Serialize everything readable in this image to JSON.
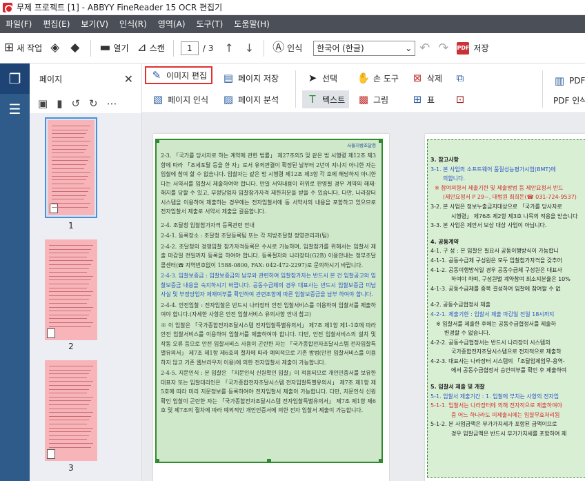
{
  "window": {
    "title": "무제 프로젝트 [1] - ABBYY FineReader 15 OCR 편집기"
  },
  "menu": [
    "파일(F)",
    "편집(E)",
    "보기(V)",
    "인식(R)",
    "영역(A)",
    "도구(T)",
    "도움말(H)"
  ],
  "toolbar": {
    "new_task": "새 작업",
    "open": "열기",
    "scan": "스캔",
    "page_current": "1",
    "page_total": "/ 3",
    "recognize": "인식",
    "language": "한국어 (한글)",
    "save": "저장"
  },
  "pages_panel": {
    "title": "페이지",
    "thumbnails": [
      {
        "number": "1"
      },
      {
        "number": "2"
      },
      {
        "number": "3"
      }
    ]
  },
  "edit_toolbar": {
    "image_edit": "이미지 편집",
    "save_page": "페이지 저장",
    "recognize_page": "페이지 인식",
    "analyze_page": "페이지 분석",
    "select": "선택",
    "hand_tool": "손 도구",
    "delete": "삭제",
    "text": "텍스트",
    "picture": "그림",
    "table": "표",
    "pdf": "PDF",
    "pdf_recognize": "PDF 인식"
  },
  "document": {
    "page1_logo": "서울지방조달청",
    "page1_paragraphs": [
      "2-3. 「국가를 당사자로 하는 계약에 관한 법률」 제27조의5 및 같은 법 시행령 제12조 제3항에 따라 「조세포탈 등을 한 자」로서 유죄판결이 확정된 날부터 2년이 지나지 아니한 자는 입찰에 참여 할 수 없습니다. 입찰자는 같은 법 시행령 제12조 제3항 각 호에 해당하지 아니한다는 서약서를 입찰시 제출하여야 합니다. 만일 서약내용이 허위로 판명될 경우 계약의 해제·해지를 당할 수 있고, 부정당업자 입찰참가자격 제한처분을 받을 수 있습니다. 다만, 나라장터 시스템을 이용하여 제출하는 경우에는 전자입찰서에 동 서약서의 내용을 포함하고 있으므로 전자입찰서 제출로 서약서 제출을 갈음합니다.",
      "2-4. 조달청 입찰참가자격 등록관련 안내",
      "2-4-1. 등록장소 : 조달청 조달등록팀 또는 각 지방조달청 정영관리과(팀)",
      "2-4-2. 조달청의 경쟁입찰 참가자격등록은 수시로 가능하며, 입찰참가를 위해서는 입찰서 제출 마감일 전일까지 등록을 하여야 합니다. 등록절차와 나라장터(G2B) 이용안내는 정부조달콜센터(☎ 지역번호없이 1588-0800, FAX: 042-472-2297)로 문의하시기 바랍니다.",
      "2-4-3. 입찰보증금 : 입찰보증금의 납부와 관련하여 입찰참가자는 반드시 본 건 입찰공고와 입찰보증금 내용을 숙지하시기 바랍니다. 공동수급체의 경우 대표사는 반드시 입찰보증금 미납사실 및 부정당업자 제재여부를 확인하여 관련조항에 따른 입찰보증금을 납부 하여야 합니다.",
      "2-4-4. 안전입찰 : 전자입찰은 반드시 나라장터 안전 입찰서비스를 이용하여 입찰서를 제출하여야 합니다.(자세한 사항은 안전 입찰서비스 유의사항 안내 참고)",
      "※ 이 입찰은 「국가종합전자조달시스템 전자입찰특별유의서」 제7조 제1항 제1-1호에 따라 안전 입찰서비스를 이용하여 입찰서를 제출하여야 합니다. 다만, 안전 입찰서비스의 설치 및 작동 오류 등으로 안전 입찰서비스 사용이 곤란한 자는 「국가종합전자조달시스템 전자입찰특별유의서」 제7조 제1항 제6호의 절차에 따라 예외적으로 기존 방법(안전 입찰서비스를 이용하지 않고 기존 웹브라우저 이용)에 의한 전자입찰서 제출이 가능합니다.",
      "2-4-5. 지문인식 : 본 입찰은 「지문인식 신원확인 입찰」이 적용되므로 개인인증서를 보유한 대표자 또는 입찰대리인은 「국가종합전자조달시스템 전자입찰특별유의서」 제7조 제1항 제5호에 따라 미리 지문정보를 등록하여야 전자입찰서 제출이 가능합니다. 다만, 지문인식 신원확인 입찰이 곤란한 자는 「국가종합전자조달시스템 전자입찰특별유의서」 제7조 제1항 제6호 및 제7조의 절차에 따라 예외적인 개인인증서에 의한 전자 입찰서 제출이 가능합니다."
    ],
    "page2_lines": [
      "3. 참고사항",
      "3-1. 본 사업의 소프트웨어 품질성능평가시험(BMT)에",
      "의합니다.",
      "※ 참여의향서 제출기한 및 제출방법 등 제안요청서 반드",
      "(제안요청서 P 29~, 대법원 최희돈(☎ 031-724-9537)",
      "3-2. 본 사업은 정보누출금지대상으로 「국가를 당사자로",
      "시행령」 제76조 제2항 제3호 나목의 적용을 받습니다",
      "3-3. 본 사업은 제안서 보상 대상 사업이 아닙니다.",
      "4. 공동계약",
      "4-1. 구 성 : 본 입찰은 필요시 공동이행방식이 가능합니",
      "4-1-1. 공동수급체 구성원은 모두 입찰참가자격을 갖추어",
      "4-1-2. 공동이행방식일 경우 공동수급체 구성원은 대표사",
      "하여야 하며, 구성원별 계약참여 최소지분율은 10%",
      "4-1-3. 공동수급체를 중복 결성하여 입찰에 참여할 수 없",
      "4-2. 공동수급협정서 제출",
      "4-2-1. 제출기한 : 입찰서 제출 마감일 전일 18시까지",
      "※ 입찰서를 제출한 후에는 공동수급협정서를 제출하",
      "변경할 수 없습니다.",
      "4-2-2. 공동수급협정서는 반드시 나라장터 시스템의",
      "국가종합전자조달시스템으로 전자적으로 제출하",
      "4-2-3. 대표사는 나라장터 시스템의 「조달업체업무-용역-",
      "에서 공동수급협정서 승인여부를 확인 후 제출하여",
      "5. 입찰서 제출 및 개찰",
      "5-1. 입찰서 제출기간 : 1. 입찰에 부치는 사항의 전자입",
      "5-1-1. 입찰서는 나라장터에 의해 전자적으로 제출하여야",
      "중 어느 하나라도 미제출시에는 입찰무효처리됨",
      "5-1-2. 본 사업금액은 부가가치세가 포함된 금액이므로",
      "경우 입찰금액은 반드시 부가가치세를 포함하여 제"
    ]
  },
  "colors": {
    "menubar": "#4a4f58",
    "rail": "#2f5b8a",
    "thumbnail": "#f7b5b9",
    "text_zone": "#cfe8c9",
    "zone_border": "#2e8b2e",
    "highlight_border": "#e03030"
  }
}
